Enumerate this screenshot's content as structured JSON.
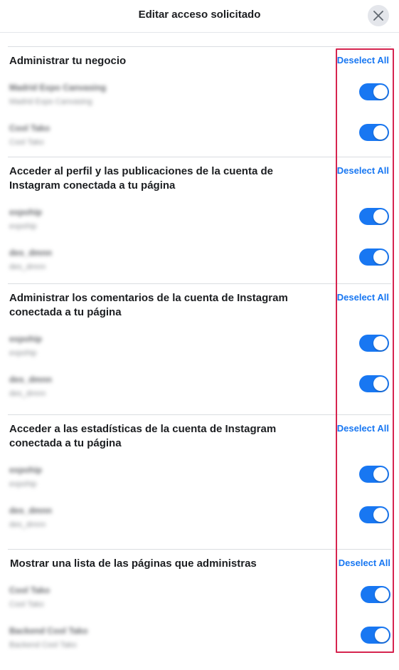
{
  "header": {
    "title": "Editar acceso solicitado",
    "close_icon": "close-icon"
  },
  "accent_color": "#1877f2",
  "highlight_color": "#d6244f",
  "sections": [
    {
      "title": "Administrar tu negocio",
      "deselect_label": "Deselect All",
      "items": [
        {
          "name": "Madrid Expo Canvasing",
          "sub": "Madrid Expo Canvasing",
          "enabled": true
        },
        {
          "name": "Cool Tako",
          "sub": "Cool Tako",
          "enabled": true
        }
      ]
    },
    {
      "title": "Acceder al perfil y las publicaciones de la cuenta de Instagram conectada a tu página",
      "deselect_label": "Deselect All",
      "items": [
        {
          "name": "expohip",
          "sub": "expohip",
          "enabled": true
        },
        {
          "name": "des_dmnn",
          "sub": "des_dmnn",
          "enabled": true
        }
      ]
    },
    {
      "title": "Administrar los comentarios de la cuenta de Instagram conectada a tu página",
      "deselect_label": "Deselect All",
      "items": [
        {
          "name": "expohip",
          "sub": "expohip",
          "enabled": true
        },
        {
          "name": "des_dmnn",
          "sub": "des_dmnn",
          "enabled": true
        }
      ]
    },
    {
      "title": "Acceder a las estadísticas de la cuenta de Instagram conectada a tu página",
      "deselect_label": "Deselect All",
      "items": [
        {
          "name": "expohip",
          "sub": "expohip",
          "enabled": true
        },
        {
          "name": "des_dmnn",
          "sub": "des_dmnn",
          "enabled": true
        }
      ]
    },
    {
      "title": "Mostrar una lista de las páginas que administras",
      "deselect_label": "Deselect All",
      "items": [
        {
          "name": "Cool Tako",
          "sub": "Cool Tako",
          "enabled": true
        },
        {
          "name": "Backend Cool Tako",
          "sub": "Backend Cool Tako",
          "enabled": true
        }
      ]
    }
  ]
}
